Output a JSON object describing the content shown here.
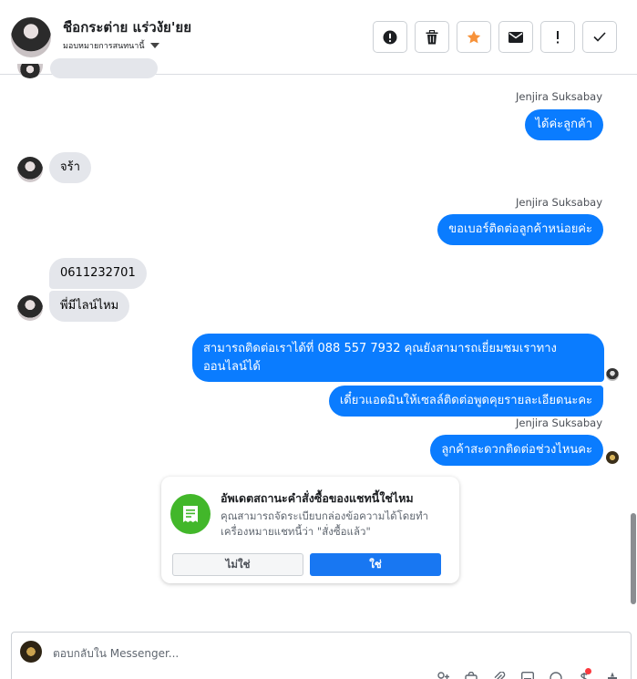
{
  "header": {
    "contact_name": "ชือกระต่าย แร่วงัย'ยย",
    "assign_label": "มอบหมายการสนทนานี้",
    "tools": [
      "alert-circle-icon",
      "trash-icon",
      "star-icon",
      "envelope-icon",
      "exclamation-icon",
      "check-icon"
    ],
    "star_color": "#f7923a"
  },
  "messages": [
    {
      "sender": "Jenjira Suksabay",
      "text": "ได้ค่ะลูกค้า",
      "dir": "out"
    },
    {
      "text": "จร้า",
      "dir": "in"
    },
    {
      "sender": "Jenjira Suksabay",
      "text": "ขอเบอร์ติดต่อลูกค้าหน่อยค่ะ",
      "dir": "out"
    },
    {
      "text": "0611232701",
      "dir": "in"
    },
    {
      "text": "พี่มีไลน์ไหม",
      "dir": "in"
    },
    {
      "text": "สามารถติดต่อเราได้ที่ 088 557 7932 คุณยังสามารถเยี่ยมชมเราทาง ออนไลน์ได้",
      "dir": "out"
    },
    {
      "text": "เดี๋ยวแอดมินให้เซลล์ติดต่อพูดคุยรายละเอียดนะคะ",
      "dir": "out"
    },
    {
      "sender": "Jenjira Suksabay",
      "text": "ลูกค้าสะดวกติดต่อช่วงไหนคะ",
      "dir": "out"
    }
  ],
  "card": {
    "title": "อัพเดตสถานะคำสั่งซื้อของแชทนี้ใช่ไหม",
    "description": "คุณสามารถจัดระเบียบกล่องข้อความได้โดยทำเครื่องหมายแชทนี้ว่า \"สั่งซื้อแล้ว\"",
    "no_label": "ไม่ใช่",
    "yes_label": "ใช่",
    "icon": "receipt-icon"
  },
  "reply": {
    "placeholder": "ตอบกลับใน Messenger..."
  },
  "colors": {
    "outgoing": "#0a7cff",
    "incoming": "#e4e6eb",
    "primary_button": "#1877f2",
    "card_icon_bg": "#42b72a"
  }
}
